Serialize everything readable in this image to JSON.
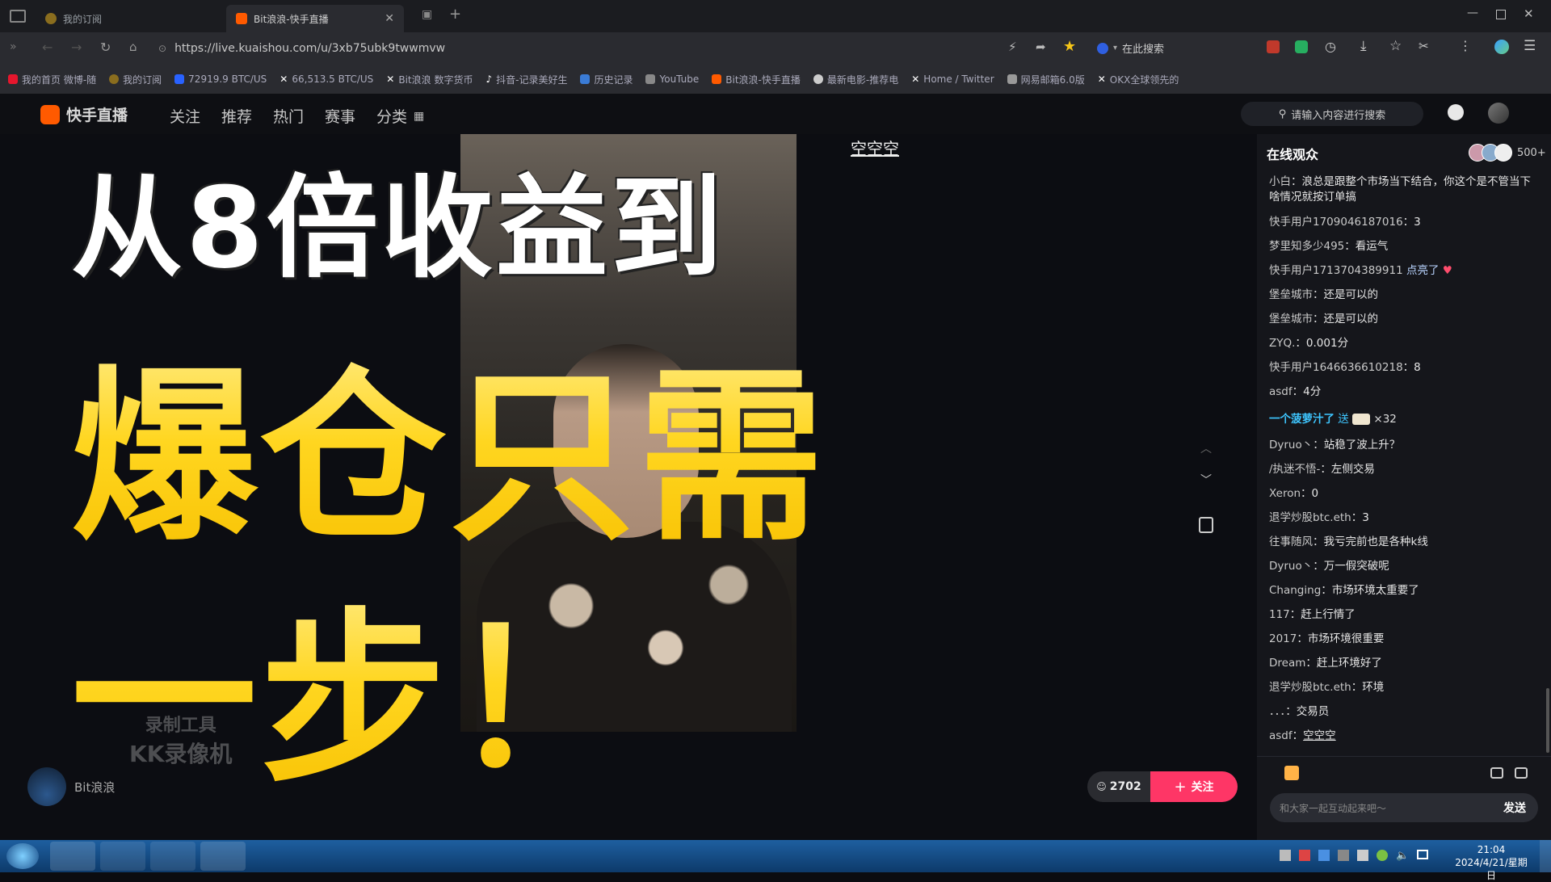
{
  "browser": {
    "tabs": [
      {
        "label": "我的订阅",
        "active": false
      },
      {
        "label": "Bit浪浪-快手直播",
        "active": true
      }
    ],
    "url": "https://live.kuaishou.com/u/3xb75ubk9twwmvw",
    "search_engine_label": "在此搜索",
    "bookmarks": [
      "我的首页 微博-随",
      "我的订阅",
      "72919.9 BTC/US",
      "66,513.5 BTC/US",
      "Bit浪浪 数字货币",
      "抖音-记录美好生",
      "历史记录",
      "YouTube",
      "Bit浪浪-快手直播",
      "最新电影-推荐电",
      "Home / Twitter",
      "网易邮箱6.0版",
      "OKX全球领先的"
    ]
  },
  "site": {
    "logo_text": "快手直播",
    "nav": [
      "关注",
      "推荐",
      "热门",
      "赛事",
      "分类"
    ],
    "search_placeholder": "请输入内容进行搜索"
  },
  "video": {
    "overlay_line1": "从8倍收益到",
    "overlay_line2": "爆仓只需",
    "overlay_line3": "一步！",
    "top_caption": "空空空",
    "watermark_line1": "录制工具",
    "watermark_line2": "KK录像机",
    "streamer_name": "Bit浪浪",
    "viewer_count": "2702",
    "follow_label": "关注"
  },
  "chat": {
    "title": "在线观众",
    "audience_count": "500+",
    "messages": [
      {
        "user": "小白",
        "text": "浪总是跟整个市场当下结合，你这个是不管当下啥情况就按订单搞"
      },
      {
        "user": "快手用户1709046187016",
        "text": "3"
      },
      {
        "user": "梦里知多少495",
        "text": "看运气"
      },
      {
        "user": "快手用户1713704389911",
        "text": "点亮了"
      },
      {
        "user": "堡垒城市",
        "text": "还是可以的"
      },
      {
        "user": "堡垒城市",
        "text": "还是可以的"
      },
      {
        "user": "ZYQ.",
        "text": "0.001分"
      },
      {
        "user": "快手用户1646636610218",
        "text": "8"
      },
      {
        "user": "asdf",
        "text": "4分"
      },
      {
        "user": "一个菠萝汁了",
        "text": "送",
        "gift": "×32"
      },
      {
        "user": "Dyruo丶",
        "text": "站稳了波上升？"
      },
      {
        "user": "/执迷不悟-",
        "text": "左侧交易"
      },
      {
        "user": "Xeron",
        "text": "0"
      },
      {
        "user": "退学炒股btc.eth",
        "text": "3"
      },
      {
        "user": "往事随风",
        "text": "我亏完前也是各种k线"
      },
      {
        "user": "Dyruo丶",
        "text": "万一假突破呢"
      },
      {
        "user": "Changing",
        "text": "市场环境太重要了"
      },
      {
        "user": "117",
        "text": "赶上行情了"
      },
      {
        "user": "2017",
        "text": "市场环境很重要"
      },
      {
        "user": "Dream",
        "text": "赶上环境好了"
      },
      {
        "user": "退学炒股btc.eth",
        "text": "环境"
      },
      {
        "user": "．．．",
        "text": "交易员"
      },
      {
        "user": "asdf",
        "text": "空空空"
      }
    ],
    "input_placeholder": "和大家一起互动起来吧～",
    "send_label": "发送"
  },
  "taskbar": {
    "time": "21:04",
    "date": "2024/4/21/星期日"
  }
}
